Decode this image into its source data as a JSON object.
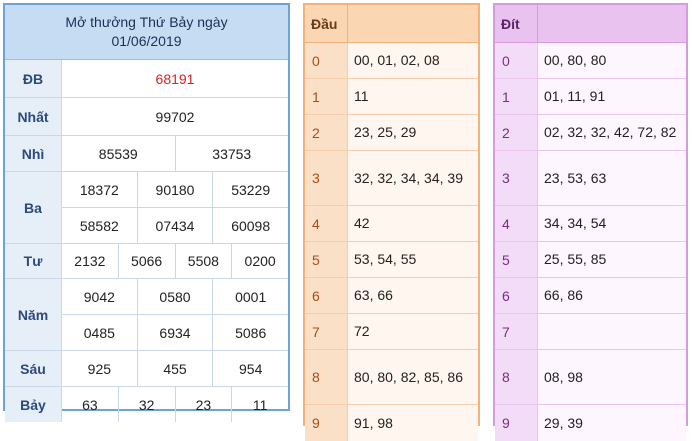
{
  "results": {
    "title": "Mở thưởng Thứ Bảy ngày",
    "date": "01/06/2019",
    "prizes": [
      {
        "label": "ĐB",
        "lines": [
          [
            "68191"
          ]
        ],
        "special": true
      },
      {
        "label": "Nhất",
        "lines": [
          [
            "99702"
          ]
        ]
      },
      {
        "label": "Nhì",
        "lines": [
          [
            "85539",
            "33753"
          ]
        ]
      },
      {
        "label": "Ba",
        "lines": [
          [
            "18372",
            "90180",
            "53229"
          ],
          [
            "58582",
            "07434",
            "60098"
          ]
        ]
      },
      {
        "label": "Tư",
        "lines": [
          [
            "2132",
            "5066",
            "5508",
            "0200"
          ]
        ]
      },
      {
        "label": "Năm",
        "lines": [
          [
            "9042",
            "0580",
            "0001"
          ],
          [
            "0485",
            "6934",
            "5086"
          ]
        ]
      },
      {
        "label": "Sáu",
        "lines": [
          [
            "925",
            "455",
            "954"
          ]
        ]
      },
      {
        "label": "Bảy",
        "lines": [
          [
            "63",
            "32",
            "23",
            "11"
          ]
        ]
      }
    ]
  },
  "dau": {
    "header": "Đầu",
    "rows": [
      {
        "key": "0",
        "values": "00, 01, 02, 08"
      },
      {
        "key": "1",
        "values": "11"
      },
      {
        "key": "2",
        "values": "23, 25, 29"
      },
      {
        "key": "3",
        "values": "32, 32, 34, 34, 39"
      },
      {
        "key": "4",
        "values": "42"
      },
      {
        "key": "5",
        "values": "53, 54, 55"
      },
      {
        "key": "6",
        "values": "63, 66"
      },
      {
        "key": "7",
        "values": "72"
      },
      {
        "key": "8",
        "values": "80, 80, 82, 85, 86"
      },
      {
        "key": "9",
        "values": "91, 98"
      }
    ]
  },
  "dit": {
    "header": "Đít",
    "rows": [
      {
        "key": "0",
        "values": "00, 80, 80"
      },
      {
        "key": "1",
        "values": "01, 11, 91"
      },
      {
        "key": "2",
        "values": "02, 32, 32, 42, 72, 82"
      },
      {
        "key": "3",
        "values": "23, 53, 63"
      },
      {
        "key": "4",
        "values": "34, 34, 54"
      },
      {
        "key": "5",
        "values": "25, 55, 85"
      },
      {
        "key": "6",
        "values": "66, 86"
      },
      {
        "key": "7",
        "values": ""
      },
      {
        "key": "8",
        "values": "08, 98"
      },
      {
        "key": "9",
        "values": "29, 39"
      }
    ]
  }
}
